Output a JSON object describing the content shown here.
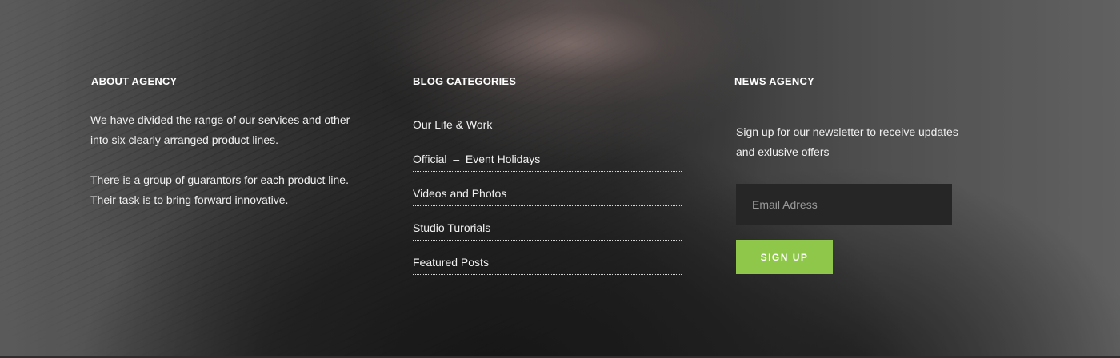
{
  "about": {
    "title": "ABOUT AGENCY",
    "paragraphs": [
      "We have divided the range of our  services and other into six  clearly arranged product lines.",
      "There is a group of guarantors for each  product line. Their task is to bring  forward innovative."
    ]
  },
  "blog": {
    "title": "BLOG CATEGORIES",
    "items": [
      "Our Life & Work",
      "Official  –  Event Holidays",
      "Videos and Photos",
      "Studio Turorials",
      "Featured Posts"
    ]
  },
  "news": {
    "title": "NEWS AGENCY",
    "text": "Sign up for our newsletter to receive updates and exlusive offers",
    "email_placeholder": "Email Adress",
    "button_label": "SIGN UP"
  },
  "colors": {
    "accent": "#8ec749",
    "input_bg": "#262626"
  }
}
